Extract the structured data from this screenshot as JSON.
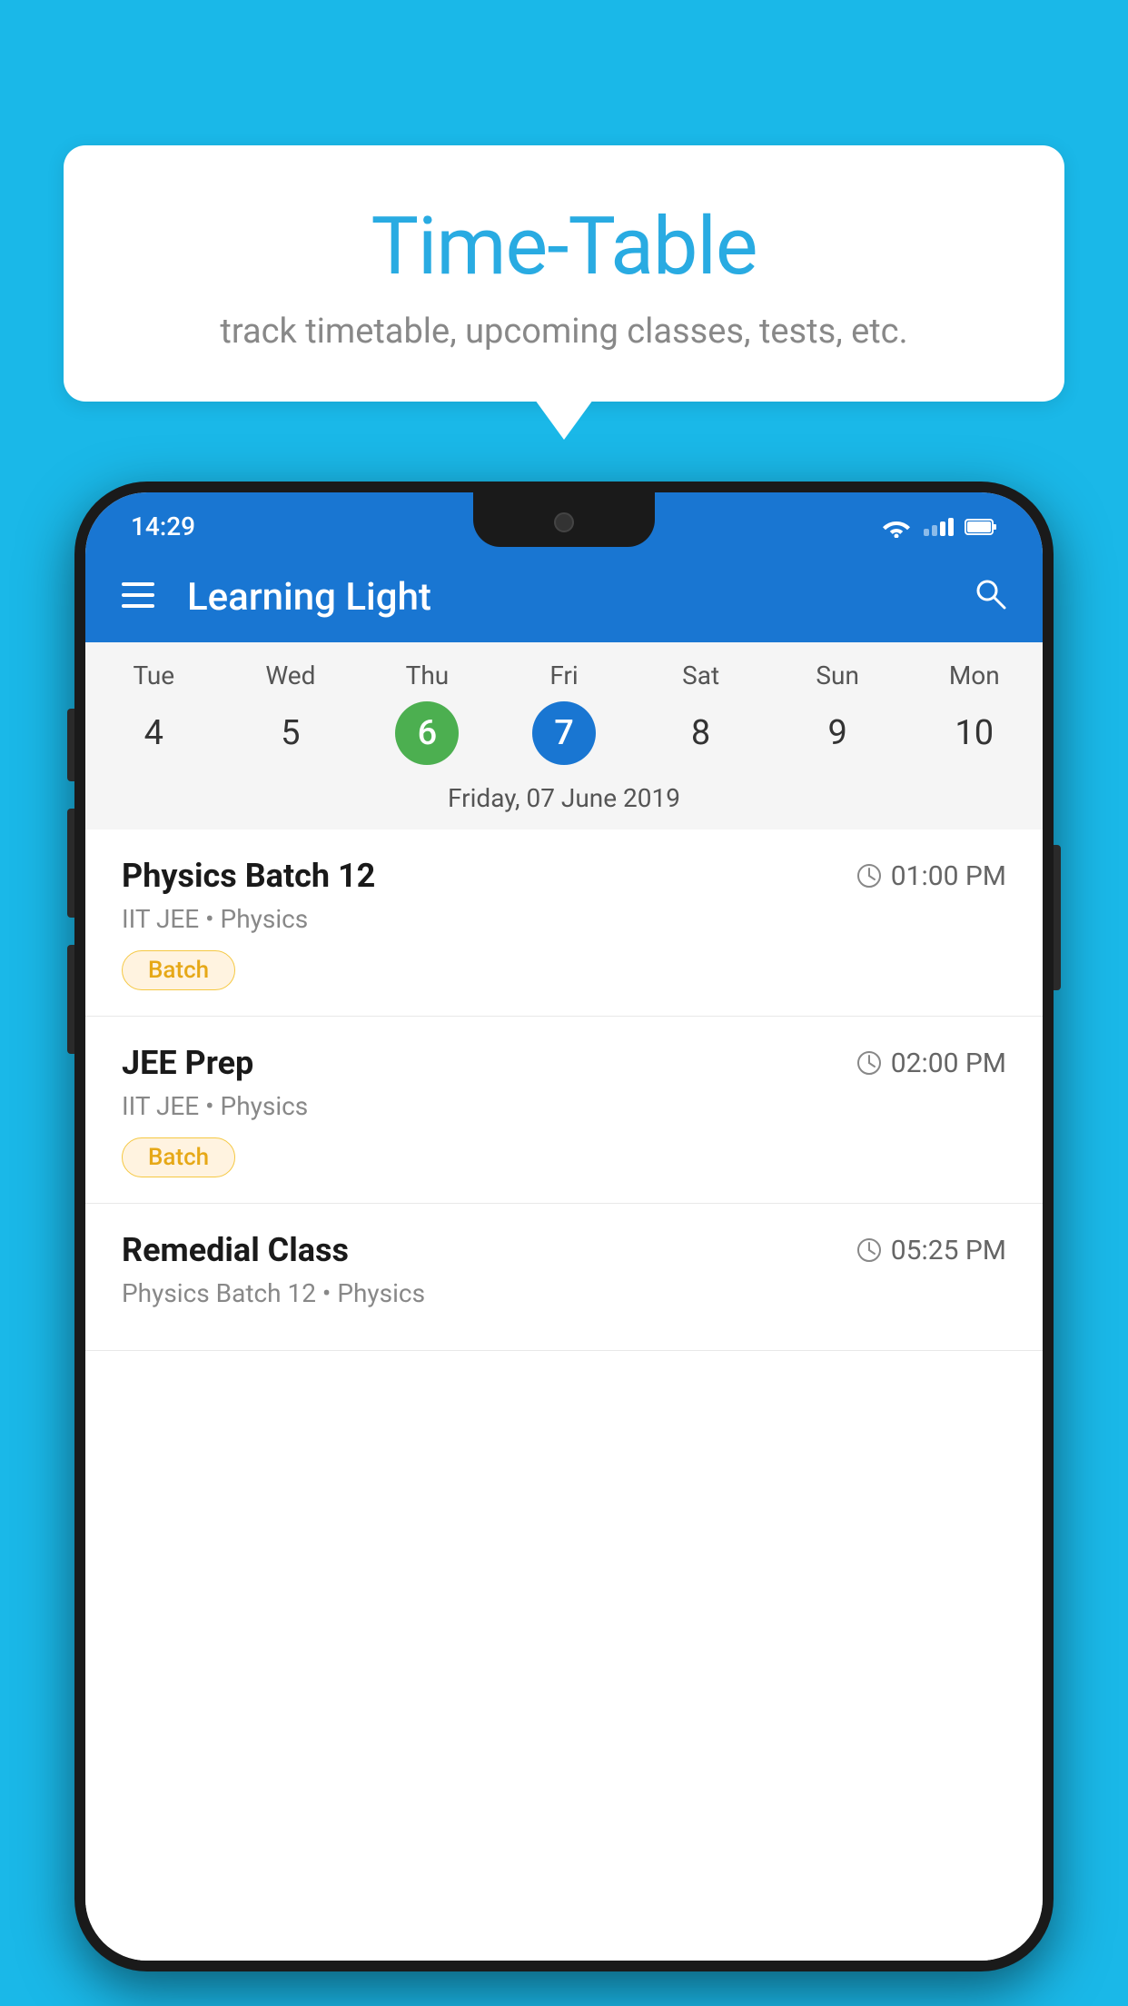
{
  "background_color": "#1ab8e8",
  "speech_bubble": {
    "title": "Time-Table",
    "subtitle": "track timetable, upcoming classes, tests, etc."
  },
  "phone": {
    "status_bar": {
      "time": "14:29"
    },
    "app_bar": {
      "title": "Learning Light"
    },
    "calendar": {
      "days": [
        {
          "name": "Tue",
          "number": "4",
          "state": "normal"
        },
        {
          "name": "Wed",
          "number": "5",
          "state": "normal"
        },
        {
          "name": "Thu",
          "number": "6",
          "state": "today"
        },
        {
          "name": "Fri",
          "number": "7",
          "state": "selected"
        },
        {
          "name": "Sat",
          "number": "8",
          "state": "normal"
        },
        {
          "name": "Sun",
          "number": "9",
          "state": "normal"
        },
        {
          "name": "Mon",
          "number": "10",
          "state": "normal"
        }
      ],
      "selected_date_label": "Friday, 07 June 2019"
    },
    "schedule": [
      {
        "title": "Physics Batch 12",
        "time": "01:00 PM",
        "subtitle": "IIT JEE • Physics",
        "tag": "Batch"
      },
      {
        "title": "JEE Prep",
        "time": "02:00 PM",
        "subtitle": "IIT JEE • Physics",
        "tag": "Batch"
      },
      {
        "title": "Remedial Class",
        "time": "05:25 PM",
        "subtitle": "Physics Batch 12 • Physics",
        "tag": null
      }
    ]
  }
}
